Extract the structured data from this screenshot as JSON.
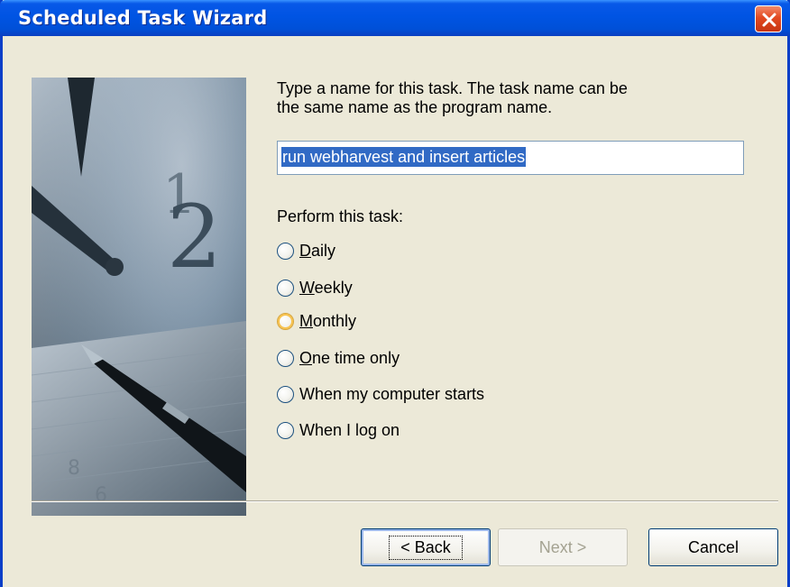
{
  "window": {
    "title": "Scheduled Task Wizard",
    "close_icon": "close-icon",
    "colors": {
      "titlebar": "#0054e3",
      "close": "#e24a21",
      "face": "#ece9d8",
      "selection": "#316ac5"
    }
  },
  "prompt": {
    "line1": "Type a name for this task.  The task name can be",
    "line2": "the same name as the program name."
  },
  "task_name": {
    "value": "run webharvest and insert articles"
  },
  "schedule": {
    "label": "Perform this task:",
    "options": [
      {
        "label": "Daily",
        "selected": false
      },
      {
        "label": "Weekly",
        "selected": false
      },
      {
        "label": "Monthly",
        "selected": false,
        "hovered": true
      },
      {
        "label": "One time only",
        "selected": false
      },
      {
        "label": "When my computer starts",
        "selected": false
      },
      {
        "label": "When I log on",
        "selected": false
      }
    ]
  },
  "buttons": {
    "back": "< Back",
    "next": "Next >",
    "cancel": "Cancel"
  }
}
